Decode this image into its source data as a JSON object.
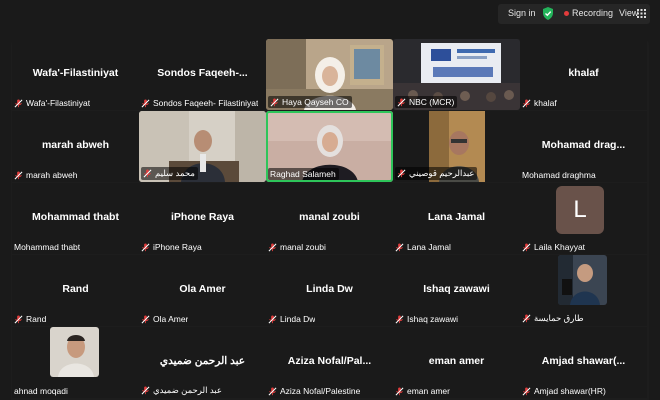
{
  "topbar": {
    "signin": "Sign in",
    "recording": "Recording",
    "view": "View",
    "icons": [
      "shield-check-icon",
      "recording-dot-icon",
      "grid-view-icon"
    ]
  },
  "colors": {
    "background": "#1a1a1a",
    "active_speaker_border": "#2ec55a",
    "muted_mic": "#e23c3c",
    "recording": "#e23c3c"
  },
  "tiles": [
    {
      "name": "Wafa'-Filastiniyat",
      "label": "Wafa'-Filastiniyat"
    },
    {
      "name": "Sondos  Faqeeh-...",
      "label": "Sondos  Faqeeh- Filastiniyat"
    },
    {
      "name": "",
      "label": "Haya Qayseh CO"
    },
    {
      "name": "",
      "label": "NBC (MCR)"
    },
    {
      "name": "khalaf",
      "label": "khalaf"
    },
    {
      "name": "marah abweh",
      "label": "marah abweh"
    },
    {
      "name": "",
      "label": "محمد سليم"
    },
    {
      "name": "",
      "label": "Raghad Salameh"
    },
    {
      "name": "",
      "label": "عبدالرحيم قوصيني"
    },
    {
      "name": "Mohamad  drag...",
      "label": "Mohamad draghma"
    },
    {
      "name": "Mohammad thabt",
      "label": "Mohammad thabt"
    },
    {
      "name": "iPhone Raya",
      "label": "iPhone Raya"
    },
    {
      "name": "manal zoubi",
      "label": "manal zoubi"
    },
    {
      "name": "Lana Jamal",
      "label": "Lana Jamal"
    },
    {
      "name": "",
      "label": "Laila Khayyat",
      "avatar": "L"
    },
    {
      "name": "Rand",
      "label": "Rand"
    },
    {
      "name": "Ola Amer",
      "label": "Ola Amer"
    },
    {
      "name": "Linda Dw",
      "label": "Linda Dw"
    },
    {
      "name": "Ishaq zawawi",
      "label": "Ishaq zawawi"
    },
    {
      "name": "",
      "label": "طارق حمايسة"
    },
    {
      "name": "",
      "label": "ahnad moqadi"
    },
    {
      "name": "عبد الرحمن ضميدي",
      "label": "عبد الرحمن ضميدي"
    },
    {
      "name": "Aziza Nofal/Pal...",
      "label": "Aziza Nofal/Palestine"
    },
    {
      "name": "eman amer",
      "label": "eman amer"
    },
    {
      "name": "Amjad  shawar(...",
      "label": "Amjad shawar(HR)"
    }
  ]
}
